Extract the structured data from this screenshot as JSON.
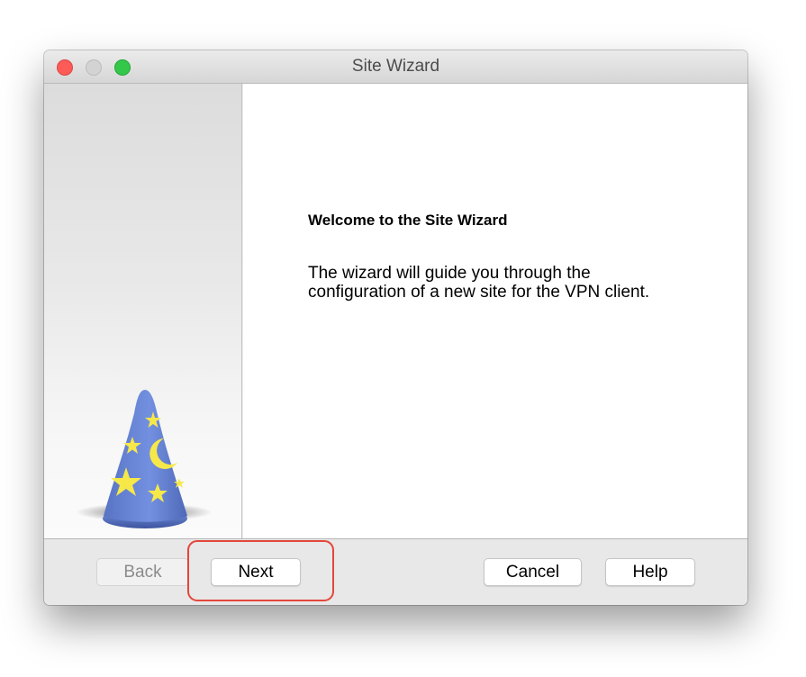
{
  "window": {
    "title": "Site Wizard"
  },
  "content": {
    "heading": "Welcome to the Site Wizard",
    "description_line1": "The wizard will guide you through the",
    "description_line2": "configuration of a new site for the VPN client."
  },
  "footer": {
    "back_label": "Back",
    "back_enabled": false,
    "next_label": "Next",
    "cancel_label": "Cancel",
    "help_label": "Help",
    "highlighted_button": "Next"
  },
  "colors": {
    "close_button": "#fc5b57",
    "minimize_button_inactive": "#d3d3d3",
    "zoom_button": "#34c84a",
    "highlight_outline": "#e4463b",
    "hat_blue": "#6b86d6",
    "hat_stars": "#f7e84a"
  },
  "icons": {
    "wizard_image": "wizard-hat-icon"
  }
}
